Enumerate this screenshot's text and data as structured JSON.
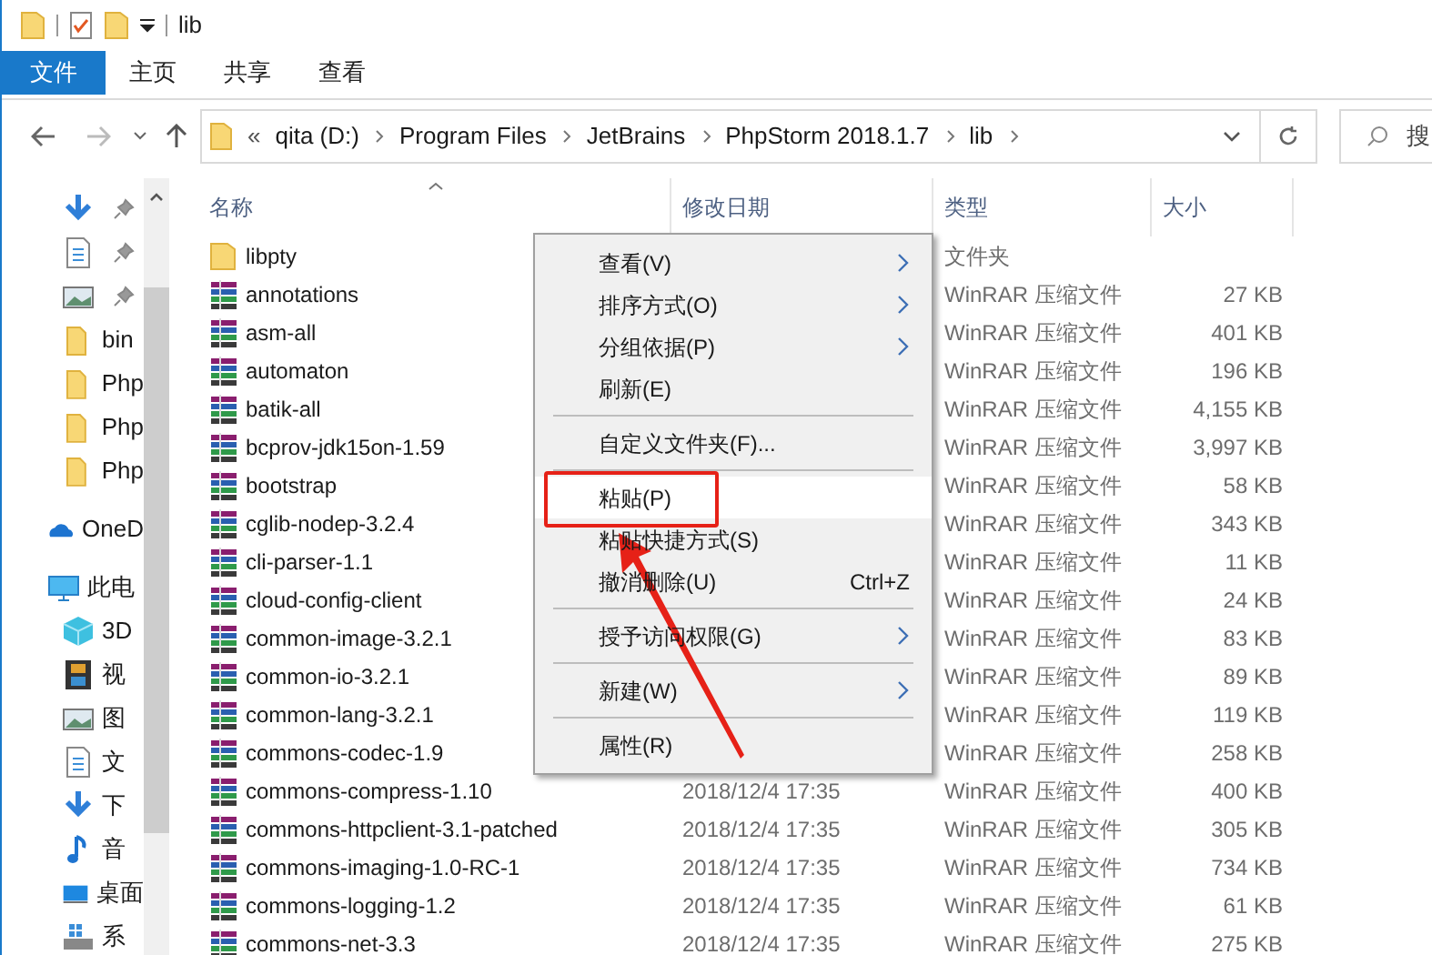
{
  "window": {
    "title": "lib"
  },
  "ribbon_tabs": [
    {
      "label": "文件",
      "selected": true
    },
    {
      "label": "主页",
      "selected": false
    },
    {
      "label": "共享",
      "selected": false
    },
    {
      "label": "查看",
      "selected": false
    }
  ],
  "address": {
    "overflow": "«",
    "parts": [
      "qita (D:)",
      "Program Files",
      "JetBrains",
      "PhpStorm 2018.1.7",
      "lib"
    ]
  },
  "search": {
    "placeholder": "搜"
  },
  "sidebar": {
    "items": [
      {
        "pinned": true
      },
      {
        "pinned": true
      },
      {
        "pinned": true
      },
      {
        "label": "bin",
        "pinned": false
      },
      {
        "label": "Php",
        "pinned": false
      },
      {
        "label": "Php",
        "pinned": false
      },
      {
        "label": "Php",
        "pinned": false
      },
      {
        "label": "OneD",
        "pinned": false
      },
      {
        "label": "此电",
        "pinned": false
      },
      {
        "label": "3D",
        "pinned": false
      },
      {
        "label": "视",
        "pinned": false
      },
      {
        "label": "图",
        "pinned": false
      },
      {
        "label": "文",
        "pinned": false
      },
      {
        "label": "下",
        "pinned": false
      },
      {
        "label": "音",
        "pinned": false
      },
      {
        "label": "桌面",
        "pinned": false
      },
      {
        "label": "系",
        "pinned": false
      }
    ]
  },
  "file_list": {
    "columns": [
      "名称",
      "修改日期",
      "类型",
      "大小"
    ],
    "rows": [
      {
        "kind": "folder",
        "name": "libpty",
        "type": "文件夹"
      },
      {
        "kind": "archive",
        "name": "annotations",
        "type": "WinRAR 压缩文件",
        "size": "27 KB"
      },
      {
        "kind": "archive",
        "name": "asm-all",
        "type": "WinRAR 压缩文件",
        "size": "401 KB"
      },
      {
        "kind": "archive",
        "name": "automaton",
        "type": "WinRAR 压缩文件",
        "size": "196 KB"
      },
      {
        "kind": "archive",
        "name": "batik-all",
        "type": "WinRAR 压缩文件",
        "size": "4,155 KB"
      },
      {
        "kind": "archive",
        "name": "bcprov-jdk15on-1.59",
        "type": "WinRAR 压缩文件",
        "size": "3,997 KB"
      },
      {
        "kind": "archive",
        "name": "bootstrap",
        "type": "WinRAR 压缩文件",
        "size": "58 KB"
      },
      {
        "kind": "archive",
        "name": "cglib-nodep-3.2.4",
        "type": "WinRAR 压缩文件",
        "size": "343 KB"
      },
      {
        "kind": "archive",
        "name": "cli-parser-1.1",
        "type": "WinRAR 压缩文件",
        "size": "11 KB"
      },
      {
        "kind": "archive",
        "name": "cloud-config-client",
        "type": "WinRAR 压缩文件",
        "size": "24 KB"
      },
      {
        "kind": "archive",
        "name": "common-image-3.2.1",
        "type": "WinRAR 压缩文件",
        "size": "83 KB"
      },
      {
        "kind": "archive",
        "name": "common-io-3.2.1",
        "type": "WinRAR 压缩文件",
        "size": "89 KB"
      },
      {
        "kind": "archive",
        "name": "common-lang-3.2.1",
        "type": "WinRAR 压缩文件",
        "size": "119 KB"
      },
      {
        "kind": "archive",
        "name": "commons-codec-1.9",
        "type": "WinRAR 压缩文件",
        "size": "258 KB"
      },
      {
        "kind": "archive",
        "name": "commons-compress-1.10",
        "date": "2018/12/4 17:35",
        "type": "WinRAR 压缩文件",
        "size": "400 KB"
      },
      {
        "kind": "archive",
        "name": "commons-httpclient-3.1-patched",
        "date": "2018/12/4 17:35",
        "type": "WinRAR 压缩文件",
        "size": "305 KB"
      },
      {
        "kind": "archive",
        "name": "commons-imaging-1.0-RC-1",
        "date": "2018/12/4 17:35",
        "type": "WinRAR 压缩文件",
        "size": "734 KB"
      },
      {
        "kind": "archive",
        "name": "commons-logging-1.2",
        "date": "2018/12/4 17:35",
        "type": "WinRAR 压缩文件",
        "size": "61 KB"
      },
      {
        "kind": "archive",
        "name": "commons-net-3.3",
        "date": "2018/12/4 17:35",
        "type": "WinRAR 压缩文件",
        "size": "275 KB"
      }
    ]
  },
  "context_menu": {
    "items": [
      {
        "kind": "item",
        "label": "查看(V)",
        "submenu": true,
        "selected": false
      },
      {
        "kind": "item",
        "label": "排序方式(O)",
        "submenu": true,
        "selected": false
      },
      {
        "kind": "item",
        "label": "分组依据(P)",
        "submenu": true,
        "selected": false
      },
      {
        "kind": "item",
        "label": "刷新(E)",
        "submenu": false,
        "selected": false
      },
      {
        "kind": "separator"
      },
      {
        "kind": "item",
        "label": "自定义文件夹(F)...",
        "submenu": false,
        "selected": false
      },
      {
        "kind": "separator"
      },
      {
        "kind": "item",
        "label": "粘贴(P)",
        "submenu": false,
        "selected": true,
        "callout": true
      },
      {
        "kind": "item",
        "label": "粘贴快捷方式(S)",
        "submenu": false,
        "selected": false
      },
      {
        "kind": "item",
        "label": "撤消删除(U)",
        "shortcut": "Ctrl+Z",
        "submenu": false,
        "selected": false
      },
      {
        "kind": "separator"
      },
      {
        "kind": "item",
        "label": "授予访问权限(G)",
        "submenu": true,
        "selected": false
      },
      {
        "kind": "separator"
      },
      {
        "kind": "item",
        "label": "新建(W)",
        "submenu": true,
        "selected": false
      },
      {
        "kind": "separator"
      },
      {
        "kind": "item",
        "label": "属性(R)",
        "submenu": false,
        "selected": false
      }
    ]
  }
}
